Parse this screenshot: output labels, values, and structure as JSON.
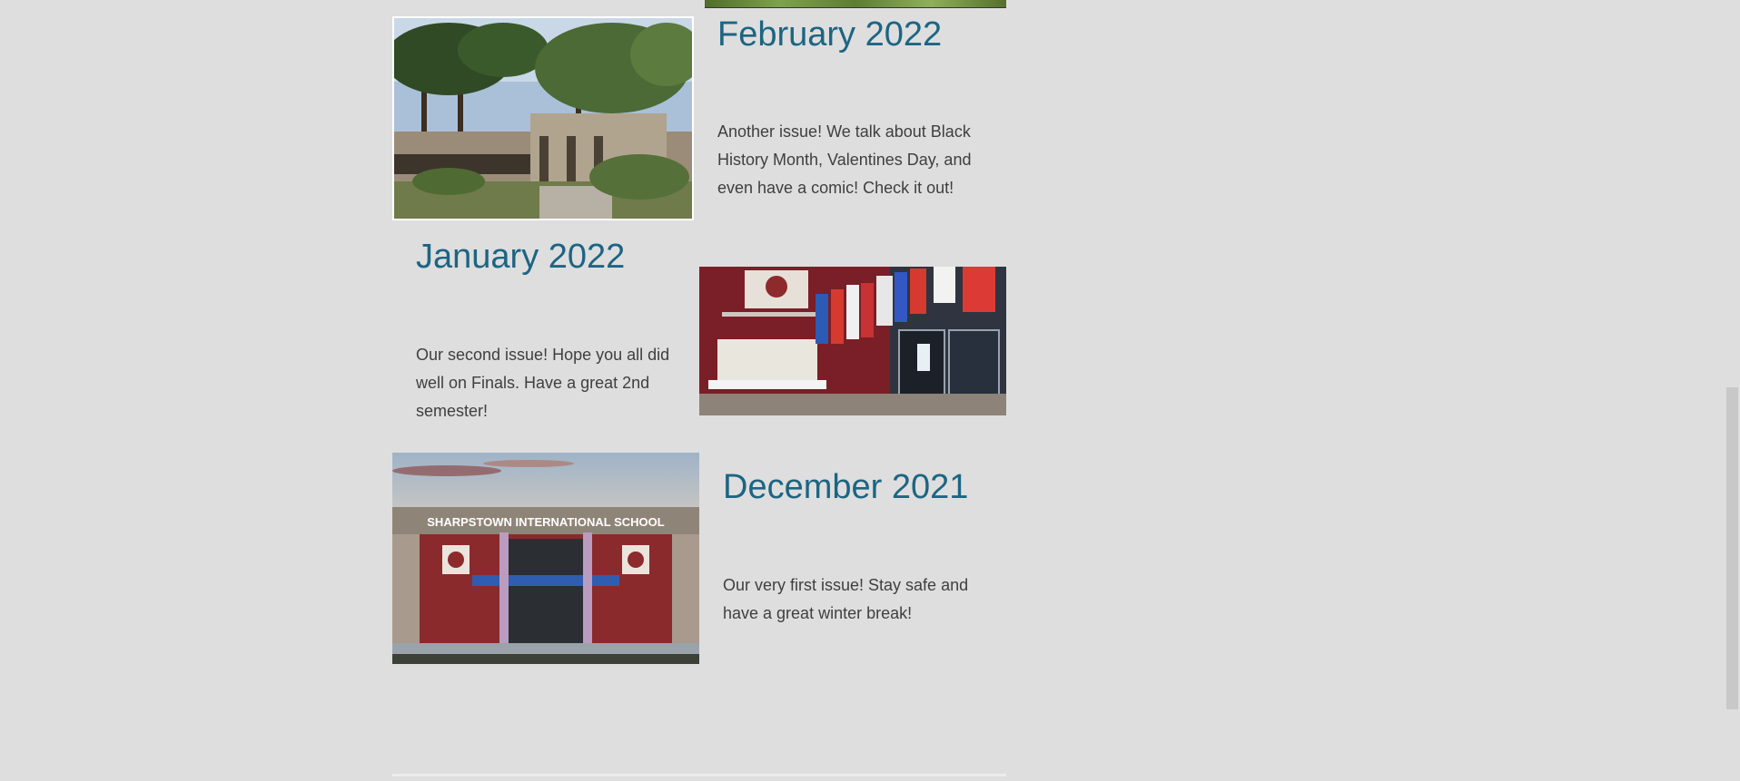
{
  "issues": [
    {
      "title": "February 2022",
      "description": "Another issue! We talk about Black History Month, Valentines Day, and even have a comic! Check it out!",
      "image_icon": "campus-courtyard-photo"
    },
    {
      "title": "January 2022",
      "description": "Our second issue! Hope you all did well on Finals. Have a great 2nd semester!",
      "image_icon": "lobby-flags-photo"
    },
    {
      "title": "December 2021",
      "description": "Our very first issue! Stay safe and have a great winter break!",
      "image_icon": "school-entrance-rendering",
      "image_sign": "SHARPSTOWN INTERNATIONAL SCHOOL"
    }
  ],
  "colors": {
    "page_bg": "#dedede",
    "heading": "#1c6583",
    "body_text": "#3f3f3f"
  }
}
